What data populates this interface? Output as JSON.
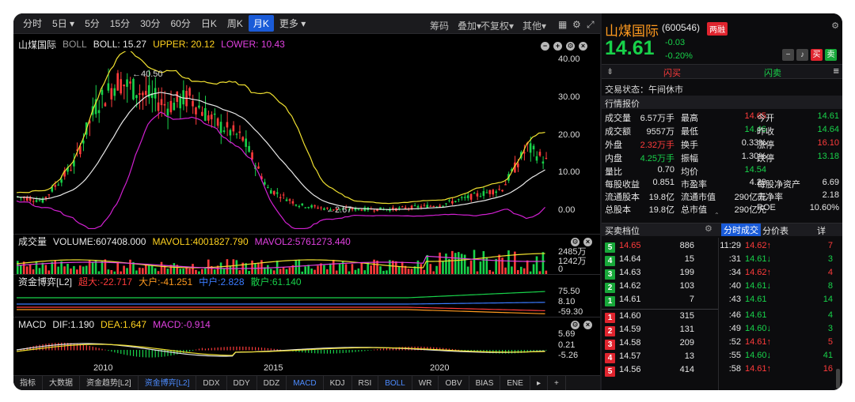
{
  "toolbar": {
    "periods": [
      "分时",
      "5日",
      "5分",
      "15分",
      "30分",
      "60分",
      "日K",
      "周K",
      "月K",
      "更多"
    ],
    "active_index": 8,
    "right": [
      "筹码",
      "叠加",
      "不复权",
      "其他"
    ]
  },
  "main": {
    "name": "山煤国际",
    "indicator": "BOLL",
    "boll": "BOLL: 15.27",
    "upper": "UPPER: 20.12",
    "lower": "LOWER: 10.43",
    "y_ticks": [
      "40.00",
      "30.00",
      "20.00",
      "10.00",
      "0.00"
    ],
    "high_label": "40.50",
    "low_label": "2.67"
  },
  "volume": {
    "title": "成交量",
    "vol": "VOLUME:607408.000",
    "mavol1": "MAVOL1:4001827.790",
    "mavol2": "MAVOL2:5761273.440",
    "y_ticks": [
      "2485万",
      "1242万",
      "0"
    ]
  },
  "fund": {
    "title": "资金博弈[L2]",
    "super": "超大:-22.717",
    "big": "大户:-41.251",
    "mid": "中户:2.828",
    "small": "散户:61.140",
    "y_ticks": [
      "75.50",
      "8.10",
      "-59.30"
    ]
  },
  "macd": {
    "title": "MACD",
    "dif": "DIF:1.190",
    "dea": "DEA:1.647",
    "macd": "MACD:-0.914",
    "y_ticks": [
      "5.69",
      "0.21",
      "-5.26"
    ]
  },
  "x_ticks": [
    "2010",
    "2015",
    "2020"
  ],
  "bottom_tabs": [
    "指标",
    "大数据",
    "资金趋势[L2]",
    "资金博弈[L2]",
    "DDX",
    "DDY",
    "DDZ",
    "MACD",
    "KDJ",
    "RSI",
    "BOLL",
    "WR",
    "OBV",
    "BIAS",
    "ENE"
  ],
  "quote": {
    "name": "山煤国际",
    "code": "(600546)",
    "tag": "两融",
    "price": "14.61",
    "chg": "-0.03",
    "pct": "-0.20%",
    "sell_btn": "闪买",
    "buy_btn": "闪卖",
    "status": "交易状态：午间休市",
    "section": "行情报价",
    "stats": [
      [
        "成交量",
        "6.57万手",
        "最高",
        "14.65",
        "今开",
        "14.61"
      ],
      [
        "成交额",
        "9557万",
        "最低",
        "14.46",
        "昨收",
        "14.64"
      ],
      [
        "外盘",
        "2.32万手",
        "换手",
        "0.33%",
        "涨停",
        "16.10"
      ],
      [
        "内盘",
        "4.25万手",
        "振幅",
        "1.30%",
        "跌停",
        "13.18"
      ],
      [
        "量比",
        "0.70",
        "均价",
        "14.54",
        "",
        ""
      ]
    ],
    "stats2": [
      [
        "每股收益",
        "0.851",
        "市盈率",
        "4.29",
        "每股净资产",
        "6.69"
      ],
      [
        "流通股本",
        "19.8亿",
        "流通市值",
        "290亿元",
        "市净率",
        "2.18"
      ],
      [
        "总股本",
        "19.8亿",
        "总市值",
        "290亿元",
        "ROE",
        "10.60%"
      ]
    ],
    "orderbook_title": "买卖档位",
    "tab_ticks": "分时成交",
    "tab_price": "分价表",
    "tab_detail": "详",
    "asks": [
      [
        "5",
        "14.65",
        "886"
      ],
      [
        "4",
        "14.64",
        "15"
      ],
      [
        "3",
        "14.63",
        "199"
      ],
      [
        "2",
        "14.62",
        "103"
      ],
      [
        "1",
        "14.61",
        "7"
      ]
    ],
    "bids": [
      [
        "1",
        "14.60",
        "315"
      ],
      [
        "2",
        "14.59",
        "131"
      ],
      [
        "3",
        "14.58",
        "209"
      ],
      [
        "4",
        "14.57",
        "13"
      ],
      [
        "5",
        "14.56",
        "414"
      ]
    ],
    "ticks": [
      [
        "11:29",
        "14.62↑",
        "7"
      ],
      [
        ":31",
        "14.61↓",
        "3"
      ],
      [
        ":34",
        "14.62↑",
        "4"
      ],
      [
        ":40",
        "14.61↓",
        "8"
      ],
      [
        ":43",
        "14.61",
        "14"
      ],
      [
        ":46",
        "14.61",
        "4"
      ],
      [
        ":49",
        "14.60↓",
        "3"
      ],
      [
        ":52",
        "14.61↑",
        "5"
      ],
      [
        ":55",
        "14.60↓",
        "41"
      ],
      [
        ":58",
        "14.61↑",
        "16"
      ]
    ]
  },
  "colors": {
    "up": "#ff3b3b",
    "down": "#18d24a",
    "upper": "#f0e030",
    "lower": "#d020d0",
    "mid": "#e8e8e8",
    "blue": "#1a5bd8"
  }
}
